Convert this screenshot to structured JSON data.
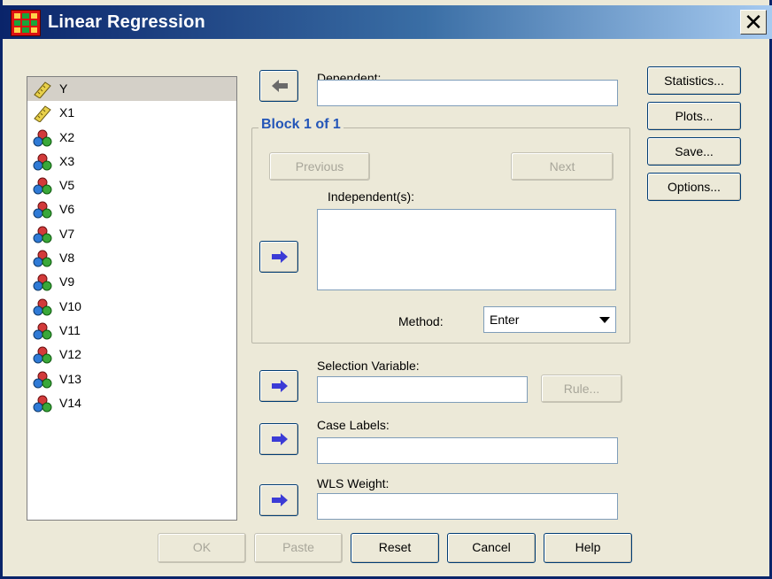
{
  "window": {
    "title": "Linear Regression"
  },
  "variables": [
    {
      "name": "Y",
      "type": "scale"
    },
    {
      "name": "X1",
      "type": "scale"
    },
    {
      "name": "X2",
      "type": "nominal"
    },
    {
      "name": "X3",
      "type": "nominal"
    },
    {
      "name": "V5",
      "type": "nominal"
    },
    {
      "name": "V6",
      "type": "nominal"
    },
    {
      "name": "V7",
      "type": "nominal"
    },
    {
      "name": "V8",
      "type": "nominal"
    },
    {
      "name": "V9",
      "type": "nominal"
    },
    {
      "name": "V10",
      "type": "nominal"
    },
    {
      "name": "V11",
      "type": "nominal"
    },
    {
      "name": "V12",
      "type": "nominal"
    },
    {
      "name": "V13",
      "type": "nominal"
    },
    {
      "name": "V14",
      "type": "nominal"
    }
  ],
  "dependent": {
    "label": "Dependent:",
    "value": ""
  },
  "block": {
    "title": "Block 1 of 1",
    "previous": "Previous",
    "next": "Next",
    "independents_label": "Independent(s):",
    "method_label": "Method:",
    "method_value": "Enter"
  },
  "selection": {
    "label": "Selection Variable:",
    "value": "",
    "rule": "Rule..."
  },
  "case_labels": {
    "label": "Case Labels:",
    "value": ""
  },
  "wls": {
    "label": "WLS Weight:",
    "value": ""
  },
  "side_buttons": {
    "statistics": "Statistics...",
    "plots": "Plots...",
    "save": "Save...",
    "options": "Options..."
  },
  "bottom_buttons": {
    "ok": "OK",
    "paste": "Paste",
    "reset": "Reset",
    "cancel": "Cancel",
    "help": "Help"
  },
  "icons": {
    "scale": "ruler-icon",
    "nominal": "nominal-balls-icon",
    "arrow": "arrow-right-icon"
  }
}
